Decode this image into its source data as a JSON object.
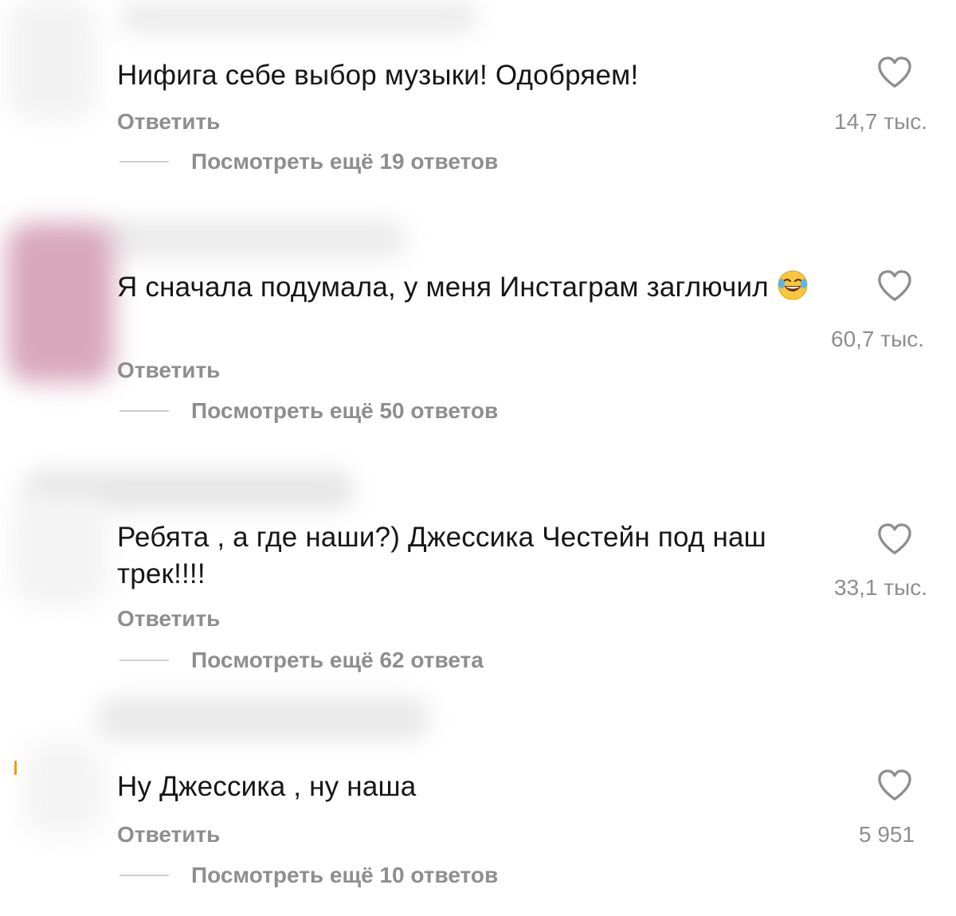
{
  "comments": [
    {
      "text": "Нифига себе выбор музыки! Одобряем!",
      "reply_label": "Ответить",
      "more_replies": "Посмотреть ещё 19 ответов",
      "likes": "14,7 тыс.",
      "icon": "heart-outline-icon"
    },
    {
      "text": "Я сначала подумала, у меня Инстаграм заглючил",
      "emoji": "😂",
      "reply_label": "Ответить",
      "more_replies": "Посмотреть ещё 50 ответов",
      "likes": "60,7 тыс.",
      "icon": "heart-outline-icon"
    },
    {
      "text": "Ребята , а где наши?) Джессика Честейн под наш трек!!!!",
      "reply_label": "Ответить",
      "more_replies": "Посмотреть ещё 62 ответа",
      "likes": "33,1 тыс.",
      "icon": "heart-outline-icon"
    },
    {
      "text": "Ну Джессика , ну наша",
      "reply_label": "Ответить",
      "more_replies": "Посмотреть ещё 10 ответов",
      "likes": "5 951",
      "icon": "heart-outline-icon"
    }
  ],
  "colors": {
    "text": "#161616",
    "secondary": "#8e8e8e",
    "divider": "#cfcfcf",
    "background": "#ffffff"
  }
}
